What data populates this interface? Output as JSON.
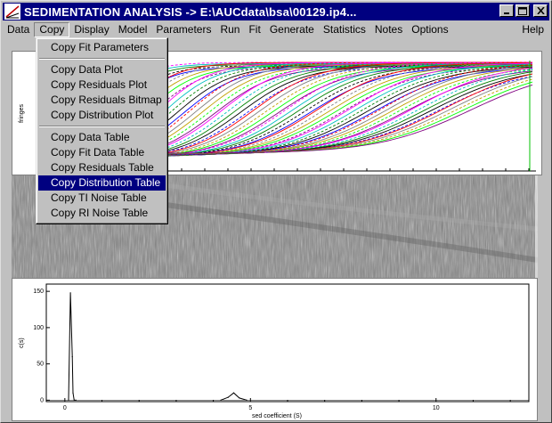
{
  "window": {
    "title": "SEDIMENTATION ANALYSIS -> E:\\AUCdata\\bsa\\00129.ip4...",
    "buttons": [
      "minimize",
      "maximize",
      "close"
    ]
  },
  "menubar": {
    "items": [
      "Data",
      "Copy",
      "Display",
      "Model",
      "Parameters",
      "Run",
      "Fit",
      "Generate",
      "Statistics",
      "Notes",
      "Options"
    ],
    "help": "Help",
    "active": "Copy"
  },
  "copy_menu": {
    "groups": [
      [
        "Copy Fit Parameters"
      ],
      [
        "Copy Data Plot",
        "Copy Residuals Plot",
        "Copy Residuals Bitmap",
        "Copy Distribution Plot"
      ],
      [
        "Copy Data Table",
        "Copy Fit Data Table",
        "Copy Residuals Table",
        "Copy Distribution Table",
        "Copy TI Noise Table",
        "Copy RI Noise Table"
      ]
    ],
    "selected": "Copy Distribution Table"
  },
  "scan_plot": {
    "ylabel": "fringes"
  },
  "chart_data": {
    "type": "line",
    "xlabel": "sed coefficient (S)",
    "ylabel": "c(s)",
    "xlim": [
      -0.5,
      12.5
    ],
    "ylim": [
      -2,
      160
    ],
    "x_ticks": [
      0,
      5,
      10
    ],
    "y_ticks": [
      0,
      50,
      100,
      150
    ],
    "series": [
      {
        "x": [
          0.1,
          0.15,
          0.2,
          0.22,
          0.25,
          0.3
        ],
        "values": [
          0,
          148,
          60,
          10,
          0,
          0
        ]
      },
      {
        "x": [
          4.2,
          4.4,
          4.55,
          4.7,
          4.9
        ],
        "values": [
          0,
          4,
          10,
          3,
          0
        ]
      }
    ]
  },
  "colors": {
    "titlebar": "#000080",
    "menu_selected": "#000080",
    "window_face": "#c0c0c0"
  }
}
